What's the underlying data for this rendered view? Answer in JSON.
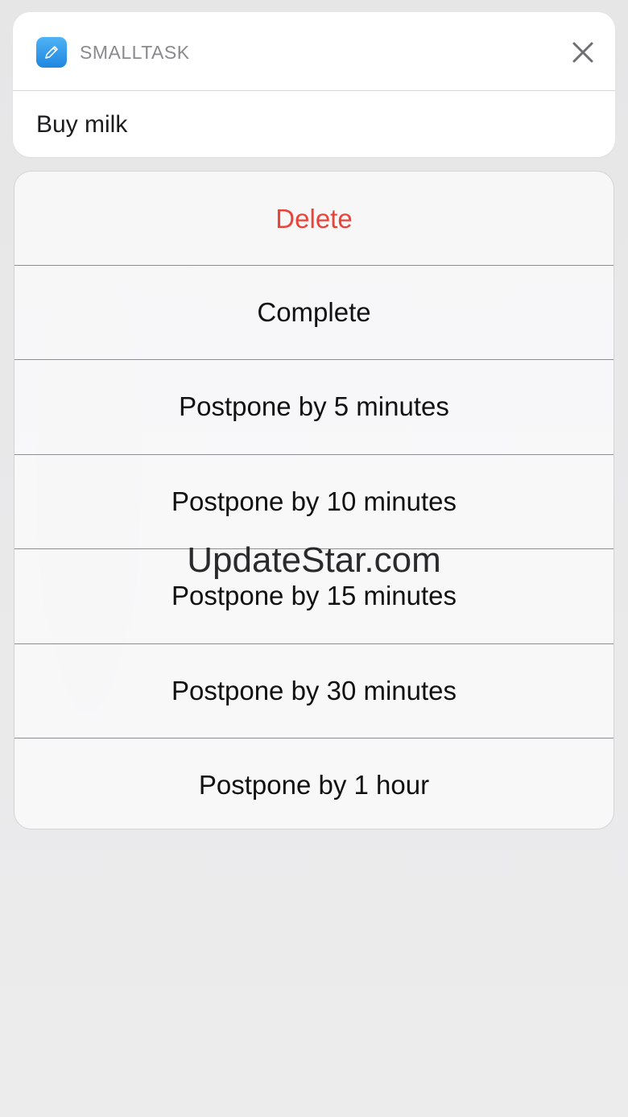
{
  "notification": {
    "app_name": "SMALLTASK",
    "body": "Buy milk",
    "icon": "pencil-icon",
    "close_icon": "close-icon",
    "app_icon_color": "#2f96ea"
  },
  "actions": [
    {
      "label": "Delete",
      "style": "destructive",
      "color": "#e8443a"
    },
    {
      "label": "Complete",
      "style": "default"
    },
    {
      "label": "Postpone by 5 minutes",
      "style": "default"
    },
    {
      "label": "Postpone by 10 minutes",
      "style": "default"
    },
    {
      "label": "Postpone by 15 minutes",
      "style": "default"
    },
    {
      "label": "Postpone by 30 minutes",
      "style": "default"
    },
    {
      "label": "Postpone by 1 hour",
      "style": "default"
    }
  ],
  "watermark": "UpdateStar.com"
}
